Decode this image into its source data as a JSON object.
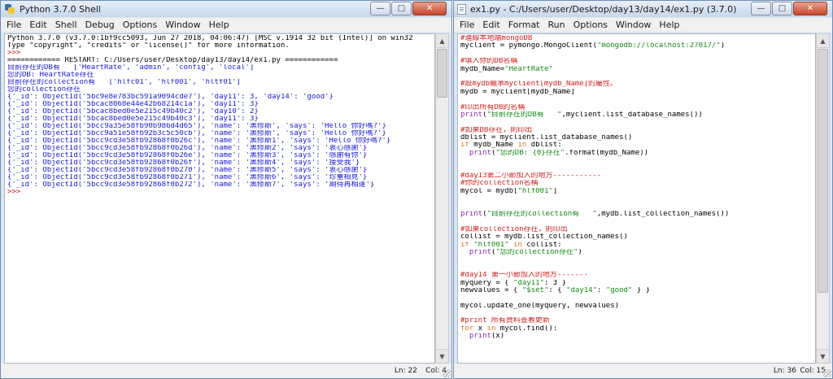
{
  "shell": {
    "title": "Python 3.7.0 Shell",
    "menu": [
      "File",
      "Edit",
      "Shell",
      "Debug",
      "Options",
      "Window",
      "Help"
    ],
    "status_line": "Ln: 22",
    "status_col": "Col: 4",
    "lines": [
      {
        "text": "Python 3.7.0 (v3.7.0:1bf9cc5093, Jun 27 2018, 04:06:47) [MSC v.1914 32 bit (Intel)] on win32",
        "color": "black"
      },
      {
        "text": "Type \"copyright\", \"credits\" or \"license()\" for more information.",
        "color": "black"
      },
      {
        "text": ">>> ",
        "color": "red"
      },
      {
        "text": "============ RESTART: C:/Users/user/Desktop/day13/day14/ex1.py ============",
        "color": "black"
      },
      {
        "text": "目前存在的DB有   ['HeartRate', 'admin', 'config', 'local']",
        "color": "blue"
      },
      {
        "text": "您的DB: HeartRate存在",
        "color": "blue"
      },
      {
        "text": "目前存在的collection有   ['hlfc01', 'hlf001', 'hltf01']",
        "color": "blue"
      },
      {
        "text": "您的collection存在",
        "color": "blue"
      },
      {
        "text": "{'_id': ObjectId('5bc9e8e783bc591a9094cde7'), 'day11': 3, 'day14': 'good'}",
        "color": "blue"
      },
      {
        "text": "{'_id': ObjectId('5bcac8068e44e42b68214c1a'), 'day11': 3}",
        "color": "blue"
      },
      {
        "text": "{'_id': ObjectId('5bcac8bed0e5e215c49b40c2'), 'day10': 2}",
        "color": "blue"
      },
      {
        "text": "{'_id': ObjectId('5bcac8bed0e5e215c49b40c3'), 'day11': 3}",
        "color": "blue"
      },
      {
        "text": "{'_id': ObjectId('5bcc9a35e58fb90b986d4d65'), 'name': '黑修斯', 'says': 'Hello 你好嗎?'}",
        "color": "blue"
      },
      {
        "text": "{'_id': ObjectId('5bcc9a51e58fb92b3c5c50cb'), 'name': '黑修斯', 'says': 'Hello 你好嗎?'}",
        "color": "blue"
      },
      {
        "text": "{'_id': ObjectId('5bcc9cd3e58fb92868f0b26c'), 'name': '黑修斯1', 'says': 'Hello 你好嗎?'}",
        "color": "blue"
      },
      {
        "text": "{'_id': ObjectId('5bcc9cd3e58fb92868f0b26d'), 'name': '黑修斯2', 'says': '衷心感謝'}",
        "color": "blue"
      },
      {
        "text": "{'_id': ObjectId('5bcc9cd3e58fb92868f0b26e'), 'name': '黑修斯3', 'says': '感謝有你'}",
        "color": "blue"
      },
      {
        "text": "{'_id': ObjectId('5bcc9cd3e58fb92868f0b26f'), 'name': '黑修斯4', 'says': '接受我'}",
        "color": "blue"
      },
      {
        "text": "{'_id': ObjectId('5bcc9cd3e58fb92868f0b270'), 'name': '黑修斯5', 'says': '衷心感謝'}",
        "color": "blue"
      },
      {
        "text": "{'_id': ObjectId('5bcc9cd3e58fb92868f0b271'), 'name': '黑修斯6', 'says': '珍重相見'}",
        "color": "blue"
      },
      {
        "text": "{'_id': ObjectId('5bcc9cd3e58fb92868f0b272'), 'name': '黑修斯7', 'says': '期待再相逢'}",
        "color": "blue"
      },
      {
        "text": ">>> ",
        "color": "red"
      }
    ]
  },
  "editor": {
    "title": "ex1.py - C:/Users/user/Desktop/day13/day14/ex1.py (3.7.0)",
    "menu": [
      "File",
      "Edit",
      "Format",
      "Run",
      "Options",
      "Window",
      "Help"
    ],
    "status_line": "Ln: 36",
    "status_col": "Col: 15",
    "lines": [
      [
        {
          "t": "#連線本地端mongoDB",
          "c": "red"
        }
      ],
      [
        {
          "t": "myclient = pymongo.MongoClient(",
          "c": "black"
        },
        {
          "t": "\"mongodb://localhost:27017/\"",
          "c": "green"
        },
        {
          "t": ")",
          "c": "black"
        }
      ],
      [],
      [
        {
          "t": "#填入你的DB名稱",
          "c": "red"
        }
      ],
      [
        {
          "t": "mydb_Name=",
          "c": "black"
        },
        {
          "t": "\"HeartRate\"",
          "c": "green"
        }
      ],
      [],
      [
        {
          "t": "#設mydb繼承myclient[mydb_Name]的屬性。",
          "c": "red"
        }
      ],
      [
        {
          "t": "mydb = myclient[mydb_Name]",
          "c": "black"
        }
      ],
      [],
      [
        {
          "t": "#印出所有DB的名稱",
          "c": "red"
        }
      ],
      [
        {
          "t": "print",
          "c": "purple"
        },
        {
          "t": "(",
          "c": "black"
        },
        {
          "t": "\"目前存在的DB有   \"",
          "c": "green"
        },
        {
          "t": ",myclient.list_database_names())",
          "c": "black"
        }
      ],
      [],
      [
        {
          "t": "#如果DB存在，則印出",
          "c": "red"
        }
      ],
      [
        {
          "t": "dblist = myclient.list_database_names()",
          "c": "black"
        }
      ],
      [
        {
          "t": "if",
          "c": "orange"
        },
        {
          "t": " mydb_Name ",
          "c": "black"
        },
        {
          "t": "in",
          "c": "orange"
        },
        {
          "t": " dblist:",
          "c": "black"
        }
      ],
      [
        {
          "t": "  ",
          "c": "black"
        },
        {
          "t": "print",
          "c": "purple"
        },
        {
          "t": "(",
          "c": "black"
        },
        {
          "t": "\"您的DB: {0}存在\"",
          "c": "green"
        },
        {
          "t": ".format(mydb_Name))",
          "c": "black"
        }
      ],
      [],
      [],
      [
        {
          "t": "#day13第二小節加入的地方-----------",
          "c": "red"
        }
      ],
      [
        {
          "t": "#你的collection名稱",
          "c": "red"
        }
      ],
      [
        {
          "t": "mycol = mydb[",
          "c": "black"
        },
        {
          "t": "\"hlf001\"",
          "c": "green"
        },
        {
          "t": "]",
          "c": "black"
        }
      ],
      [],
      [],
      [
        {
          "t": "print",
          "c": "purple"
        },
        {
          "t": "(",
          "c": "black"
        },
        {
          "t": "\"目前存在的collection有   \"",
          "c": "green"
        },
        {
          "t": ",mydb.list_collection_names())",
          "c": "black"
        }
      ],
      [],
      [
        {
          "t": "#如果collection存在，則印出",
          "c": "red"
        }
      ],
      [
        {
          "t": "collist = mydb.list_collection_names()",
          "c": "black"
        }
      ],
      [
        {
          "t": "if",
          "c": "orange"
        },
        {
          "t": " ",
          "c": "black"
        },
        {
          "t": "\"hlf001\"",
          "c": "green"
        },
        {
          "t": " ",
          "c": "black"
        },
        {
          "t": "in",
          "c": "orange"
        },
        {
          "t": " collist:",
          "c": "black"
        }
      ],
      [
        {
          "t": "  ",
          "c": "black"
        },
        {
          "t": "print",
          "c": "purple"
        },
        {
          "t": "(",
          "c": "black"
        },
        {
          "t": "\"您的collection存在\"",
          "c": "green"
        },
        {
          "t": ")",
          "c": "black"
        }
      ],
      [],
      [],
      [
        {
          "t": "#day14 第一小節加入的地方-------",
          "c": "red"
        }
      ],
      [
        {
          "t": "myquery = { ",
          "c": "black"
        },
        {
          "t": "\"day11\"",
          "c": "green"
        },
        {
          "t": ": 3 }",
          "c": "black"
        }
      ],
      [
        {
          "t": "newvalues = { ",
          "c": "black"
        },
        {
          "t": "\"$set\"",
          "c": "green"
        },
        {
          "t": ": { ",
          "c": "black"
        },
        {
          "t": "\"day14\"",
          "c": "green"
        },
        {
          "t": ": ",
          "c": "black"
        },
        {
          "t": "\"good\"",
          "c": "green"
        },
        {
          "t": " } }",
          "c": "black"
        }
      ],
      [],
      [
        {
          "t": "mycol.update_one(myquery, newvalues)",
          "c": "black"
        }
      ],
      [],
      [
        {
          "t": "#print 所有資料查看更新",
          "c": "red"
        }
      ],
      [
        {
          "t": "for",
          "c": "orange"
        },
        {
          "t": " x ",
          "c": "black"
        },
        {
          "t": "in",
          "c": "orange"
        },
        {
          "t": " mycol.find():",
          "c": "black"
        }
      ],
      [
        {
          "t": "  ",
          "c": "black"
        },
        {
          "t": "print",
          "c": "purple"
        },
        {
          "t": "(x)",
          "c": "black"
        }
      ]
    ]
  },
  "window_controls": {
    "minimize": "—",
    "maximize": "□",
    "close": "✕"
  }
}
